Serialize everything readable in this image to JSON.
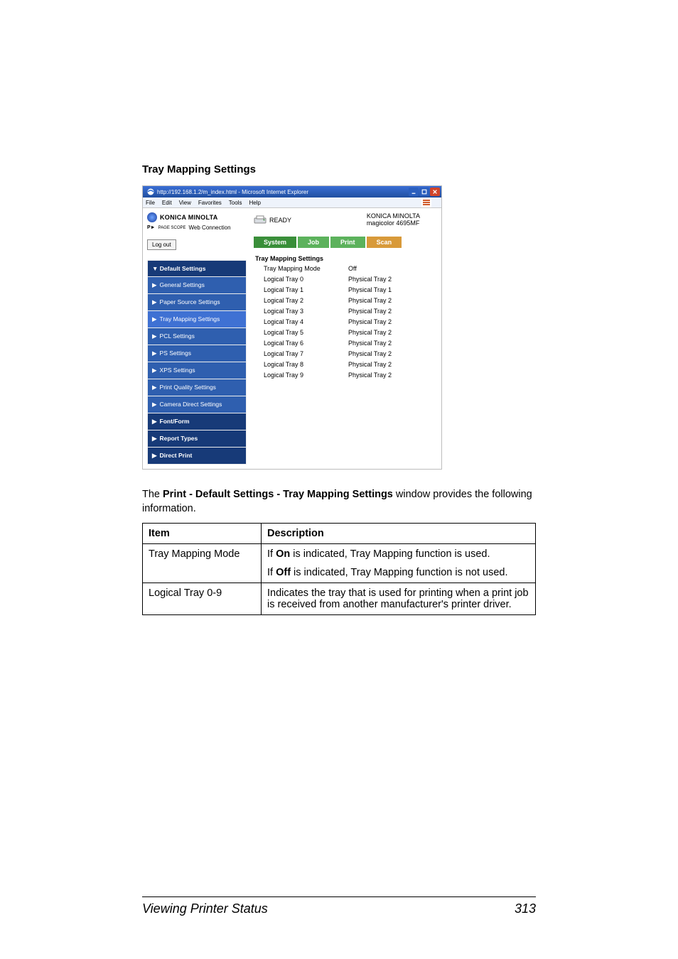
{
  "section_title": "Tray Mapping Settings",
  "window": {
    "title": "http://192.168.1.2/m_index.html - Microsoft Internet Explorer",
    "menus": [
      "File",
      "Edit",
      "View",
      "Favorites",
      "Tools",
      "Help"
    ]
  },
  "brand": {
    "name": "KONICA MINOLTA",
    "sub_prefix": "PAGE SCOPE",
    "sub": "Web Connection"
  },
  "status_text": "READY",
  "device": {
    "maker": "KONICA MINOLTA",
    "model": "magicolor 4695MF"
  },
  "logout_label": "Log out",
  "tabs": {
    "system": "System",
    "job": "Job",
    "print": "Print",
    "scan": "Scan"
  },
  "sidebar": {
    "header": "▼ Default Settings",
    "items": [
      "General Settings",
      "Paper Source Settings",
      "Tray Mapping Settings",
      "PCL Settings",
      "PS Settings",
      "XPS Settings",
      "Print Quality Settings",
      "Camera Direct Settings"
    ],
    "font_form": "Font/Form",
    "report_types": "Report Types",
    "direct_print": "Direct Print"
  },
  "panel_title": "Tray Mapping Settings",
  "mapping": [
    {
      "k": "Tray Mapping Mode",
      "v": "Off"
    },
    {
      "k": "Logical Tray 0",
      "v": "Physical Tray 2"
    },
    {
      "k": "Logical Tray 1",
      "v": "Physical Tray 1"
    },
    {
      "k": "Logical Tray 2",
      "v": "Physical Tray 2"
    },
    {
      "k": "Logical Tray 3",
      "v": "Physical Tray 2"
    },
    {
      "k": "Logical Tray 4",
      "v": "Physical Tray 2"
    },
    {
      "k": "Logical Tray 5",
      "v": "Physical Tray 2"
    },
    {
      "k": "Logical Tray 6",
      "v": "Physical Tray 2"
    },
    {
      "k": "Logical Tray 7",
      "v": "Physical Tray 2"
    },
    {
      "k": "Logical Tray 8",
      "v": "Physical Tray 2"
    },
    {
      "k": "Logical Tray 9",
      "v": "Physical Tray 2"
    }
  ],
  "explain": {
    "pre": "The ",
    "bold": "Print - Default Settings - Tray Mapping Settings",
    "post": " window provides the following information."
  },
  "table": {
    "head_item": "Item",
    "head_desc": "Description",
    "rows": [
      {
        "item": "Tray Mapping Mode",
        "p1_pre": "If ",
        "p1_bold": "On",
        "p1_post": " is indicated, Tray Mapping function is used.",
        "p2_pre": "If ",
        "p2_bold": "Off",
        "p2_post": " is indicated, Tray Mapping function is not used."
      },
      {
        "item": "Logical Tray 0-9",
        "single": "Indicates the tray that is used for printing when a print job is received from another manufacturer's printer driver."
      }
    ]
  },
  "footer": {
    "text": "Viewing Printer Status",
    "page": "313"
  }
}
